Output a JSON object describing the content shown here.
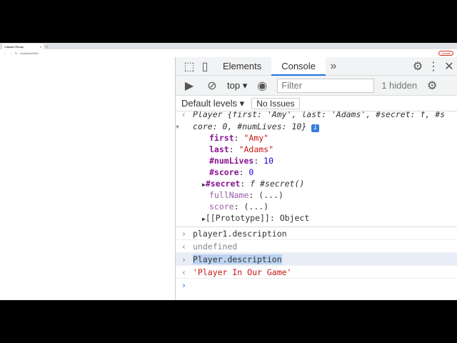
{
  "browser": {
    "tab_title": "Classes Recap",
    "url": "localhost:5501",
    "update_label": "Update"
  },
  "devtools": {
    "tabs": [
      "Elements",
      "Console"
    ],
    "context": "top",
    "filter_placeholder": "Filter",
    "hidden": "1 hidden",
    "levels": "Default levels",
    "issues": "No Issues"
  },
  "console": {
    "obj_head1": "Player {first: 'Amy', last: 'Adams', #secret: f, #s",
    "obj_head2": "core: 0, #numLives: 10}",
    "info": "i",
    "props": [
      {
        "k": "first",
        "v": "\"Amy\""
      },
      {
        "k": "last",
        "v": "\"Adams\""
      },
      {
        "k": "#numLives",
        "v": "10"
      },
      {
        "k": "#score",
        "v": "0"
      }
    ],
    "secret_k": "#secret",
    "secret_v": "f #secret()",
    "fullName_k": "fullName",
    "fullName_v": "(...)",
    "score_k": "score",
    "score_v": "(...)",
    "proto_k": "[[Prototype]]",
    "proto_v": "Object",
    "cmd1": "player1.description",
    "res1": "undefined",
    "cmd2": "Player.description",
    "res2": "'Player In Our Game'"
  }
}
